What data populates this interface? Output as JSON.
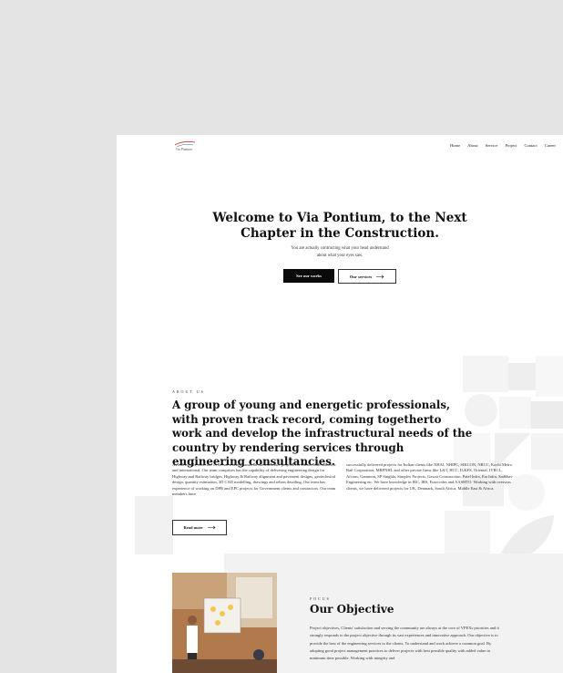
{
  "header": {
    "logo_text": "Via Pontium",
    "nav": [
      "Home",
      "About",
      "Service",
      "Project",
      "Contact",
      "Career"
    ]
  },
  "hero": {
    "title_line1": "Welcome to Via Pontium, to the Next",
    "title_line2": "Chapter in the Construction.",
    "sub_line1": "You are actually contructing what your head understand",
    "sub_line2": "about what your eyes saw.",
    "primary_button": "See our works",
    "secondary_button": "Our services"
  },
  "about": {
    "eyebrow": "ABOUT US",
    "title": "A group of young and energetic professionals, with proven track record, coming togetherto work and develop the infrastructural needs of the country by rendering services through engineering consultancies.",
    "col1": "As individuals, each one of us has worked hands on infrastructure projects for clients both domestic and international. Our team comprises has the capability of delivering engineering design for Highway and Railway bridges, Highway & Railway alignment and pavement designs, geotechnical design, quantity estimation, 3D CAD modelling, drawings and rebars detailing. Our team has experience of working on DPR and EPC projects for Government clients and contractors. Our team members have",
    "col2": "successfully delivered projects for Indian clients like NHAI, NHIPC, SIKCON, NRCC, Kochi Metro Rail Corporation, MRPNHL and other private firms like L&T, HCC, IL&FS, Oriental, IVRCL, Afcons, Gammon, SP Singhla, Simplex Projects, Gawar Construction, Patel Infra, Era Infra, Sadbhav Engineering etc. We have knowledge in IRC, IRS, Eurocodes and AASHTO. Working with overseas clients, we have delivered projects for UK, Denmark, South Africa, Middle East & Africa.",
    "button": "Read more"
  },
  "objective": {
    "eyebrow": "FOCUS",
    "title": "Our Objective",
    "text": "Project objectives, Clients' satisfaction and serving the community are always at the core of VPEXs priorities and it strongly responds to the project objective through its vast experiences and innovative approach. Our objective is to provide the best of the engineering services to the clients. To understand and work achieve a common goal. By adopting good project management practices to deliver projects with best possible quality with added value in minimum time possible. Working with integrity and"
  },
  "icons": {
    "arrow": "arrow-right-icon"
  }
}
